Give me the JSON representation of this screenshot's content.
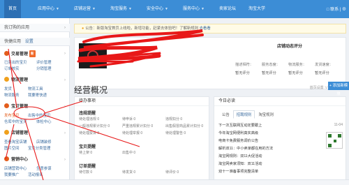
{
  "topnav": {
    "items": [
      {
        "label": "首页",
        "active": true
      },
      {
        "label": "应用中心"
      },
      {
        "label": "店铺运营"
      },
      {
        "label": "淘宝服务"
      },
      {
        "label": "安全中心"
      },
      {
        "label": "服务中心"
      },
      {
        "label": "卖家论坛"
      },
      {
        "label": "淘宝大学"
      }
    ],
    "right": "□ 联系 | ⊕"
  },
  "sidebar": {
    "my_apps": "我订购的应用",
    "quick_apps": "快捷应用",
    "quick_apps_settings": "设置",
    "groups": [
      {
        "title": "交易管理",
        "color": "#e35d1c",
        "tag": "新",
        "subs": [
          "已卖出的宝贝",
          "评价管理",
          "订单核实",
          "分销管理"
        ]
      },
      {
        "title": "物流管理",
        "color": "#f0a01c",
        "subs": [
          "发货",
          "物流工具",
          "物流服务",
          "我要寄快递"
        ]
      },
      {
        "title": "宝贝管理",
        "color": "#e35d1c",
        "subs": [
          "发布宝贝",
          "出售中的宝贝",
          "仓库中的宝贝",
          "体检中心"
        ]
      },
      {
        "title": "店铺管理",
        "color": "#f0a01c",
        "subs": [
          "查看淘宝店铺",
          "店铺装修",
          "图片空间",
          "宝贝分类管理"
        ]
      },
      {
        "title": "营销中心",
        "color": "#e35d1c",
        "subs": [
          "店铺营销中心",
          "生意参谋",
          "我要推广",
          "活动报名"
        ]
      }
    ]
  },
  "main": {
    "notice_label": "公告",
    "notice_text": "新版淘宝首页上线啦，新增功能，赶紧去体验吧！了解新规则",
    "notice_link": "去看看",
    "eval": {
      "title": "店铺动态评分",
      "labels": [
        "描述相符：",
        "服务态度：",
        "物流服务："
      ],
      "values": [
        "暂无评分",
        "暂无评分",
        "暂无评分"
      ],
      "labels2": [
        "发货速度：",
        "退款速度：",
        "纠纷率："
      ],
      "values2": [
        "暂无评分",
        "暂无评分",
        "暂无评分"
      ]
    },
    "overview_title": "经营概况",
    "settings_link": "首页设置 ∨",
    "add_button": "+ 添加新模块"
  },
  "todo": {
    "title": "待办事项",
    "groups": [
      {
        "title": "违规提醒",
        "items": [
          "待处理违规 0",
          "待申诉 0",
          "违规扣分 0",
          "一般违规累计扣分 0",
          "严重违规累计扣分 0",
          "出售假冒商品累计扣分 0",
          "待处理投诉 0",
          "待处理举报 0",
          "待处理警告 0"
        ]
      },
      {
        "title": "宝贝提醒",
        "items": [
          "待上架 0",
          "出售中 0"
        ]
      },
      {
        "title": "订单提醒",
        "items": [
          "待付款 0",
          "待发货 0",
          "待评价 0"
        ]
      }
    ]
  },
  "today": {
    "title": "今日必读",
    "tabs": [
      "公告",
      "招聘规则",
      "淘宝规则"
    ],
    "news": [
      {
        "text": "下一次互联网互动定要跟上",
        "date": "11-04"
      },
      {
        "text": "今年淘宝网便利真实高级",
        "date": "11-04"
      },
      {
        "text": "电商卡免费服务调价公告",
        "date": "11-02"
      },
      {
        "text": "解析双11：中小卖家都在用的方法",
        "date": "11-01"
      },
      {
        "text": "淘宝网规则：双11大促活动",
        "date": "10-31"
      },
      {
        "text": "淘宝网卖家须知：双11活动",
        "date": "10-30"
      },
      {
        "text": "双十一准备事项完整清单",
        "date": "10-29"
      }
    ]
  },
  "colors": {
    "nav": "#3c8dd6",
    "accent": "#e35d1c",
    "link": "#3c6da0"
  }
}
